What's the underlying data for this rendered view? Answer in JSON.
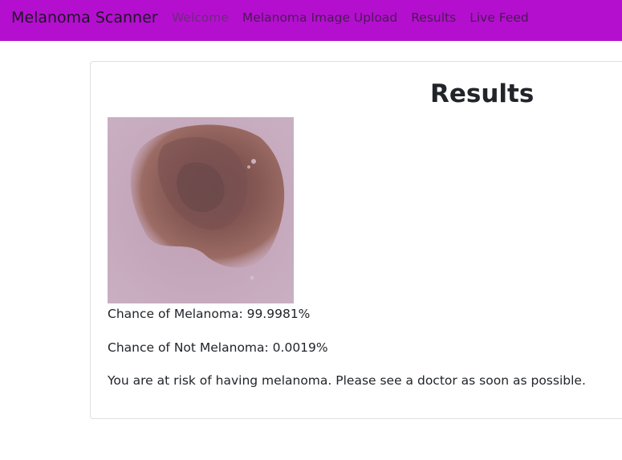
{
  "navbar": {
    "brand": "Melanoma Scanner",
    "links": [
      "Welcome",
      "Melanoma Image Upload",
      "Results",
      "Live Feed"
    ],
    "background": "#b40fcf"
  },
  "results": {
    "title": "Results",
    "image_alt_icon": "skin-lesion-image",
    "chance_melanoma": "Chance of Melanoma: 99.9981%",
    "chance_not_melanoma": "Chance of Not Melanoma: 0.0019%",
    "advice": "You are at risk of having melanoma. Please see a doctor as soon as possible."
  }
}
